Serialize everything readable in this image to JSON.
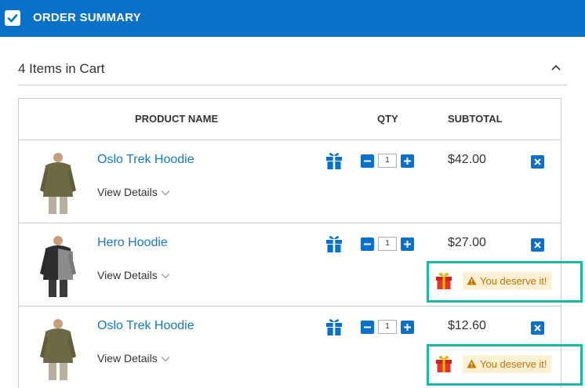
{
  "header": {
    "title": "ORDER SUMMARY",
    "accent": "#0a71c9"
  },
  "cart": {
    "count_label": "4 Items in Cart"
  },
  "table": {
    "headers": {
      "product": "PRODUCT NAME",
      "qty": "QTY",
      "subtotal": "SUBTOTAL"
    },
    "rows": [
      {
        "name": "Oslo Trek Hoodie",
        "details": "View Details",
        "qty": "1",
        "subtotal": "$42.00",
        "promo": null,
        "icon": "gift-icon",
        "image": "olive-hoodie-photo"
      },
      {
        "name": "Hero Hoodie",
        "details": "View Details",
        "qty": "1",
        "subtotal": "$27.00",
        "promo": "You deserve it!",
        "icon": "gift-icon",
        "image": "black-gray-hoodie-photo"
      },
      {
        "name": "Oslo Trek Hoodie",
        "details": "View Details",
        "qty": "1",
        "subtotal": "$12.60",
        "promo": "You deserve it!",
        "icon": "gift-icon",
        "image": "olive-hoodie-photo"
      }
    ]
  },
  "colors": {
    "link": "#1979c3",
    "highlight": "#1fb7a0",
    "badge_bg": "#fdf0d5",
    "badge_text": "#c07600"
  }
}
